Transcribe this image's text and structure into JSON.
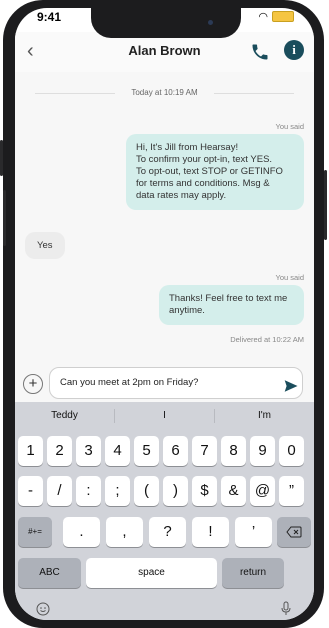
{
  "status": {
    "time": "9:41"
  },
  "header": {
    "title": "Alan Brown"
  },
  "chat": {
    "date": "Today at 10:19 AM",
    "you_said_1": "You said",
    "msg1_lines": [
      "Hi, It's Jill from Hearsay!",
      "To confirm your opt-in, text YES.",
      "To opt-out, text STOP or GETINFO",
      "for terms and conditions. Msg &",
      "data rates may apply."
    ],
    "reply": "Yes",
    "you_said_2": "You said",
    "msg2_lines": [
      "Thanks! Feel free to text me",
      "anytime."
    ],
    "delivered": "Delivered at 10:22 AM"
  },
  "composer": {
    "text": "Can you meet at 2pm on Friday?"
  },
  "keyboard": {
    "suggestions": [
      "Teddy",
      "I",
      "I'm"
    ],
    "row1": [
      "1",
      "2",
      "3",
      "4",
      "5",
      "6",
      "7",
      "8",
      "9",
      "0"
    ],
    "row2": [
      "-",
      "/",
      ":",
      ";",
      "(",
      ")",
      "$",
      "&",
      "@",
      "”"
    ],
    "row3_left": "#+=",
    "row3": [
      ".",
      ",",
      "?",
      "!",
      "’"
    ],
    "abc": "ABC",
    "space": "space",
    "return": "return"
  },
  "colors": {
    "accent": "#1a4d5c",
    "bubble_out": "#d4eeeb",
    "bubble_in": "#ececec"
  },
  "icons": [
    "back-chevron-icon",
    "phone-icon",
    "info-icon",
    "plus-icon",
    "send-icon",
    "backspace-icon",
    "emoji-icon",
    "microphone-icon"
  ]
}
